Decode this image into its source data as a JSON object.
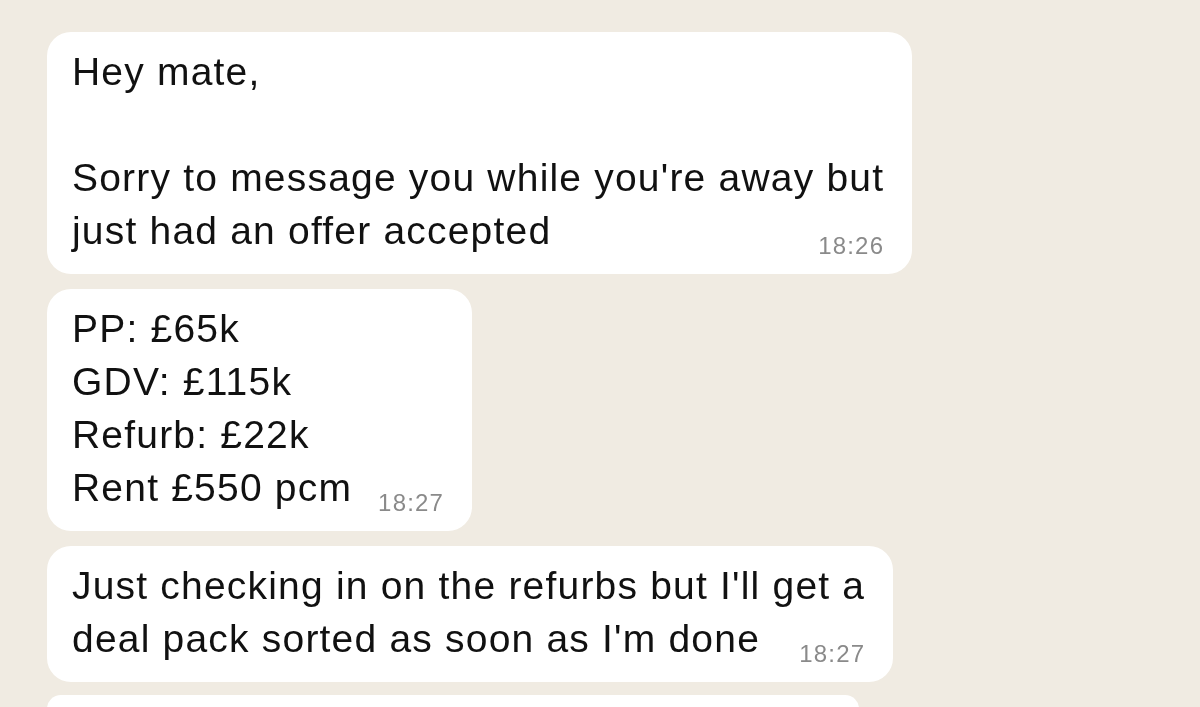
{
  "messages": [
    {
      "paragraphs": [
        {
          "lines": [
            "Hey mate,"
          ]
        },
        {
          "lines": [
            "Sorry to message you while you're away but",
            "just had an offer accepted"
          ]
        }
      ],
      "time": "18:26"
    },
    {
      "paragraphs": [
        {
          "lines": [
            "PP: £65k",
            "GDV: £115k",
            "Refurb: £22k",
            "Rent £550 pcm"
          ]
        }
      ],
      "time": "18:27"
    },
    {
      "paragraphs": [
        {
          "lines": [
            "Just checking in on the refurbs but I'll get a",
            "deal pack sorted as soon as I'm done"
          ]
        }
      ],
      "time": "18:27"
    }
  ],
  "more_below": true
}
